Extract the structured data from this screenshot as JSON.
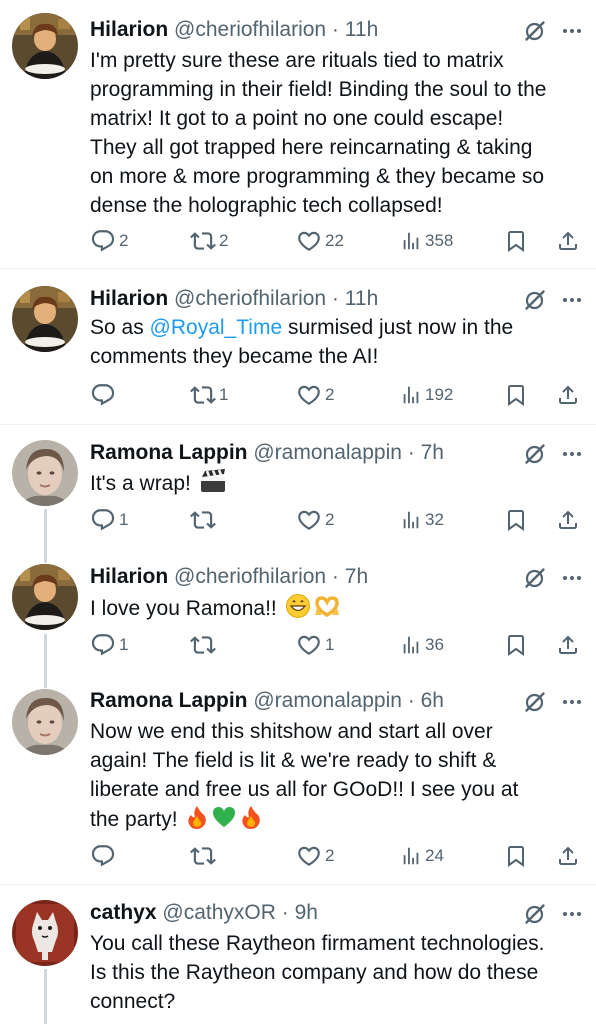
{
  "tweets": [
    {
      "name": "Hilarion",
      "handle": "@cheriofhilarion",
      "time": "11h",
      "avatar": "avatar-hilarion",
      "lines": [
        "I'm pretty sure these are rituals tied to matrix",
        "programming in their field! Binding the soul to the",
        "matrix!  It got to a point no one could escape!",
        "They all got trapped here reincarnating & taking",
        "on more & more programming & they became so",
        "dense the holographic tech collapsed!"
      ],
      "replies": "2",
      "reposts": "2",
      "likes": "22",
      "views": "358"
    },
    {
      "name": "Hilarion",
      "handle": "@cheriofhilarion",
      "time": "11h",
      "avatar": "avatar-hilarion",
      "line1_pre": "So as ",
      "mention": "@Royal_Time",
      "line1_post": " surmised just now in the",
      "line2": "comments they became the AI!",
      "replies": "",
      "reposts": "1",
      "likes": "2",
      "views": "192"
    },
    {
      "name": "Ramona Lappin",
      "handle": "@ramonalappin",
      "time": "7h",
      "avatar": "avatar-ramona",
      "text": "It's a wrap! ",
      "emoji": [
        "clapper-board"
      ],
      "replies": "1",
      "reposts": "",
      "likes": "2",
      "views": "32"
    },
    {
      "name": "Hilarion",
      "handle": "@cheriofhilarion",
      "time": "7h",
      "avatar": "avatar-hilarion",
      "text": "I love you Ramona!! ",
      "emoji": [
        "grinning-face",
        "heart-hands"
      ],
      "replies": "1",
      "reposts": "",
      "likes": "1",
      "views": "36"
    },
    {
      "name": "Ramona Lappin",
      "handle": "@ramonalappin",
      "time": "6h",
      "avatar": "avatar-ramona",
      "lines": [
        "Now we end this shitshow and start all over",
        "again! The field is lit & we're ready to shift &",
        "liberate and free us all for GOoD!! I see you at"
      ],
      "last_line": "the party! ",
      "emoji": [
        "fire",
        "green-heart",
        "fire"
      ],
      "replies": "",
      "reposts": "",
      "likes": "2",
      "views": "24"
    },
    {
      "name": "cathyx",
      "handle": "@cathyxOR",
      "time": "9h",
      "avatar": "avatar-cathyx",
      "lines": [
        "You call these Raytheon firmament technologies.",
        "Is this the Raytheon company and how do these",
        "connect?"
      ]
    }
  ],
  "separator": " · ",
  "colors": {
    "text": "#0f1419",
    "secondary": "#536471",
    "link": "#1d9bf0",
    "divider": "#eff3f4",
    "thread": "#cfd9de"
  }
}
